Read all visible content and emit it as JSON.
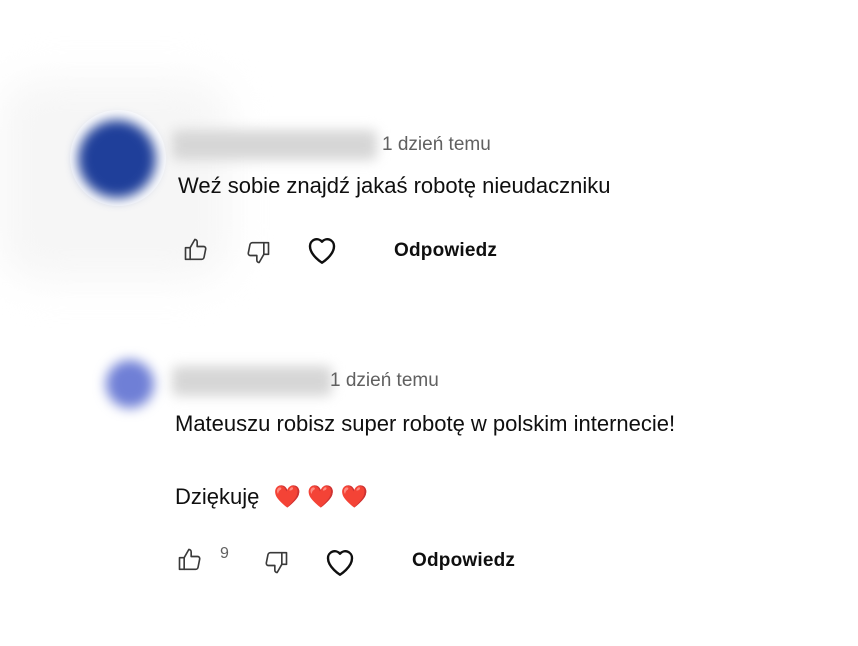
{
  "comments": [
    {
      "author": "",
      "time": "1 dzień temu",
      "text_lines": [
        "Weź sobie znajdź jakaś robotę nieudaczniku"
      ],
      "likes": "",
      "reply_label": "Odpowiedz",
      "avatar_color": "#1f3f9a"
    },
    {
      "author": "",
      "time": "1 dzień temu",
      "text_lines": [
        "Mateuszu robisz super robotę w polskim internecie!",
        "Dziękuję"
      ],
      "emojis": "❤️ ❤️ ❤️",
      "likes": "9",
      "reply_label": "Odpowiedz",
      "avatar_color": "#6f7fd6"
    }
  ]
}
